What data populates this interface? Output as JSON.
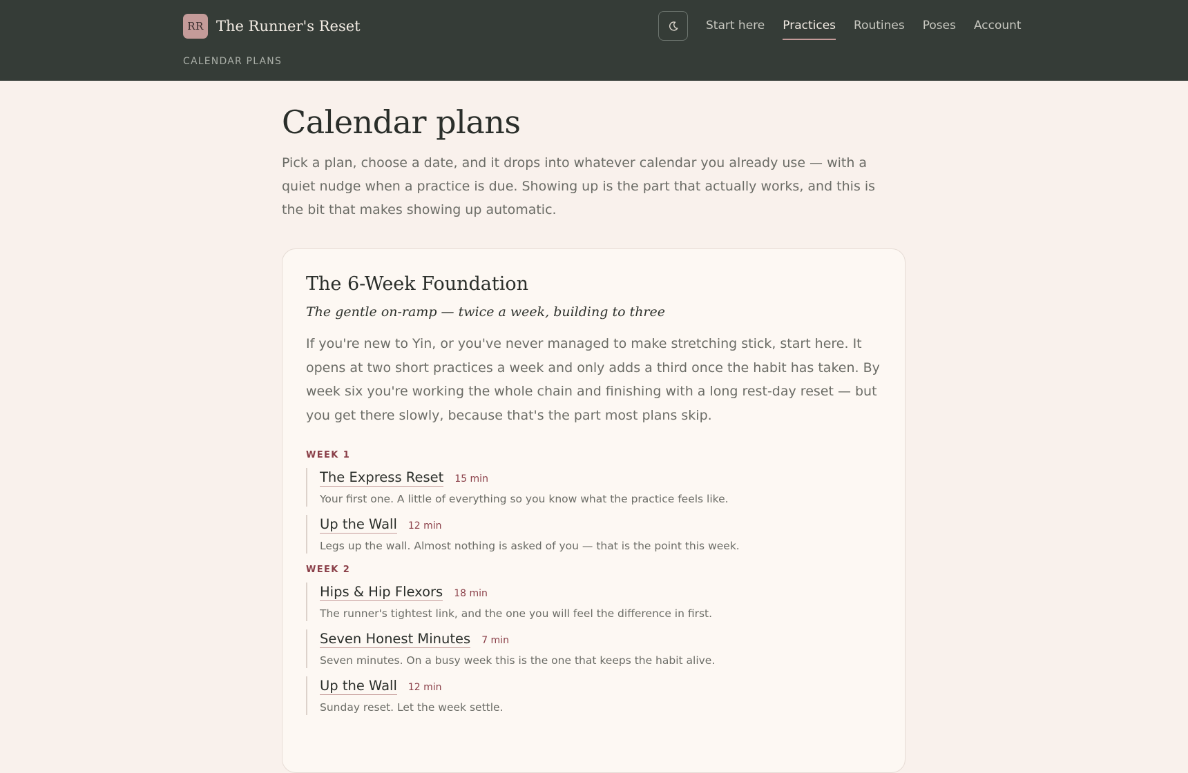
{
  "header": {
    "brand_initials": "RR",
    "brand_name": "The Runner's Reset",
    "section_label": "CALENDAR PLANS",
    "theme_toggle_icon": "moon-icon",
    "nav": [
      {
        "label": "Start here",
        "active": false
      },
      {
        "label": "Practices",
        "active": true
      },
      {
        "label": "Routines",
        "active": false
      },
      {
        "label": "Poses",
        "active": false
      },
      {
        "label": "Account",
        "active": false
      }
    ]
  },
  "main": {
    "title": "Calendar plans",
    "intro": "Pick a plan, choose a date, and it drops into whatever calendar you already use — with a quiet nudge when a practice is due. Showing up is the part that actually works, and this is the bit that makes showing up automatic."
  },
  "plan": {
    "title": "The 6-Week Foundation",
    "tagline": "The gentle on-ramp — twice a week, building to three",
    "description": "If you're new to Yin, or you've never managed to make stretching stick, start here. It opens at two short practices a week and only adds a third once the habit has taken. By week six you're working the whole chain and finishing with a long rest-day reset — but you get there slowly, because that's the part most plans skip.",
    "weeks": [
      {
        "label": "WEEK 1",
        "sessions": [
          {
            "title": "The Express Reset",
            "duration": "15 min",
            "note": "Your first one. A little of everything so you know what the practice feels like."
          },
          {
            "title": "Up the Wall",
            "duration": "12 min",
            "note": "Legs up the wall. Almost nothing is asked of you — that is the point this week."
          }
        ]
      },
      {
        "label": "WEEK 2",
        "sessions": [
          {
            "title": "Hips & Hip Flexors",
            "duration": "18 min",
            "note": "The runner's tightest link, and the one you will feel the difference in first."
          },
          {
            "title": "Seven Honest Minutes",
            "duration": "7 min",
            "note": "Seven minutes. On a busy week this is the one that keeps the habit alive."
          },
          {
            "title": "Up the Wall",
            "duration": "12 min",
            "note": "Sunday reset. Let the week settle."
          }
        ]
      }
    ]
  },
  "colors": {
    "header_bg": "#353c37",
    "page_bg": "#f9f1ec",
    "accent": "#8a3f48",
    "brand_mark": "#c49b99"
  }
}
